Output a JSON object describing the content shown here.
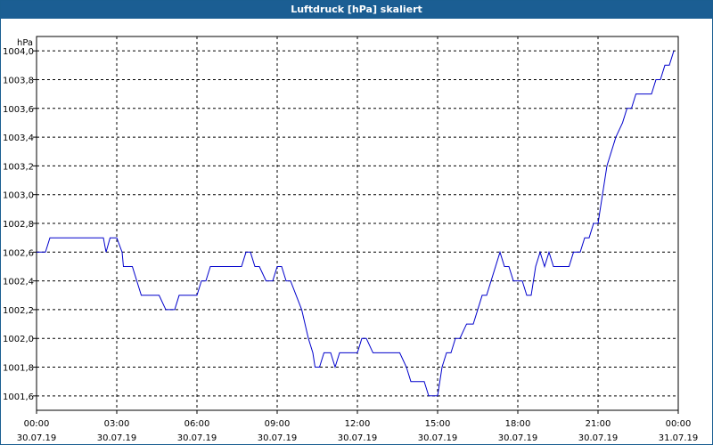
{
  "window": {
    "title": "Luftdruck [hPa] skaliert"
  },
  "chart_data": {
    "type": "line",
    "title": "Luftdruck [hPa] skaliert",
    "ylabel": "hPa",
    "xlabel": "",
    "ylim": [
      1001.5,
      1004.1
    ],
    "y_ticks": [
      "1001,6",
      "1001,8",
      "1002,0",
      "1002,2",
      "1002,4",
      "1002,6",
      "1002,8",
      "1003,0",
      "1003,2",
      "1003,4",
      "1003,6",
      "1003,8",
      "1004,0"
    ],
    "x_ticks": [
      {
        "time": "00:00",
        "date": "30.07.19"
      },
      {
        "time": "03:00",
        "date": "30.07.19"
      },
      {
        "time": "06:00",
        "date": "30.07.19"
      },
      {
        "time": "09:00",
        "date": "30.07.19"
      },
      {
        "time": "12:00",
        "date": "30.07.19"
      },
      {
        "time": "15:00",
        "date": "30.07.19"
      },
      {
        "time": "18:00",
        "date": "30.07.19"
      },
      {
        "time": "21:00",
        "date": "30.07.19"
      },
      {
        "time": "00:00",
        "date": "31.07.19"
      }
    ],
    "grid": true,
    "series": [
      {
        "color": "#0000cc",
        "points": [
          [
            "30.07.19 00:00",
            1002.6
          ],
          [
            "30.07.19 00:20",
            1002.6
          ],
          [
            "30.07.19 00:30",
            1002.7
          ],
          [
            "30.07.19 02:30",
            1002.7
          ],
          [
            "30.07.19 02:36",
            1002.6
          ],
          [
            "30.07.19 02:45",
            1002.7
          ],
          [
            "30.07.19 03:00",
            1002.7
          ],
          [
            "30.07.19 03:12",
            1002.6
          ],
          [
            "30.07.19 03:15",
            1002.5
          ],
          [
            "30.07.19 03:35",
            1002.5
          ],
          [
            "30.07.19 03:55",
            1002.3
          ],
          [
            "30.07.19 04:35",
            1002.3
          ],
          [
            "30.07.19 04:50",
            1002.2
          ],
          [
            "30.07.19 05:10",
            1002.2
          ],
          [
            "30.07.19 05:20",
            1002.3
          ],
          [
            "30.07.19 05:55",
            1002.3
          ],
          [
            "30.07.19 06:00",
            1002.3
          ],
          [
            "30.07.19 06:10",
            1002.4
          ],
          [
            "30.07.19 06:20",
            1002.4
          ],
          [
            "30.07.19 06:30",
            1002.5
          ],
          [
            "30.07.19 07:40",
            1002.5
          ],
          [
            "30.07.19 07:50",
            1002.6
          ],
          [
            "30.07.19 08:00",
            1002.6
          ],
          [
            "30.07.19 08:10",
            1002.5
          ],
          [
            "30.07.19 08:20",
            1002.5
          ],
          [
            "30.07.19 08:35",
            1002.4
          ],
          [
            "30.07.19 08:50",
            1002.4
          ],
          [
            "30.07.19 09:00",
            1002.5
          ],
          [
            "30.07.19 09:10",
            1002.5
          ],
          [
            "30.07.19 09:20",
            1002.4
          ],
          [
            "30.07.19 09:30",
            1002.4
          ],
          [
            "30.07.19 09:55",
            1002.2
          ],
          [
            "30.07.19 10:10",
            1002.0
          ],
          [
            "30.07.19 10:20",
            1001.9
          ],
          [
            "30.07.19 10:25",
            1001.8
          ],
          [
            "30.07.19 10:35",
            1001.8
          ],
          [
            "30.07.19 10:45",
            1001.9
          ],
          [
            "30.07.19 11:00",
            1001.9
          ],
          [
            "30.07.19 11:10",
            1001.8
          ],
          [
            "30.07.19 11:20",
            1001.9
          ],
          [
            "30.07.19 12:00",
            1001.9
          ],
          [
            "30.07.19 12:10",
            1002.0
          ],
          [
            "30.07.19 12:20",
            1002.0
          ],
          [
            "30.07.19 12:35",
            1001.9
          ],
          [
            "30.07.19 13:35",
            1001.9
          ],
          [
            "30.07.19 13:50",
            1001.8
          ],
          [
            "30.07.19 14:00",
            1001.7
          ],
          [
            "30.07.19 14:30",
            1001.7
          ],
          [
            "30.07.19 14:40",
            1001.6
          ],
          [
            "30.07.19 15:00",
            1001.6
          ],
          [
            "30.07.19 15:10",
            1001.8
          ],
          [
            "30.07.19 15:20",
            1001.9
          ],
          [
            "30.07.19 15:30",
            1001.9
          ],
          [
            "30.07.19 15:40",
            1002.0
          ],
          [
            "30.07.19 15:50",
            1002.0
          ],
          [
            "30.07.19 16:05",
            1002.1
          ],
          [
            "30.07.19 16:20",
            1002.1
          ],
          [
            "30.07.19 16:40",
            1002.3
          ],
          [
            "30.07.19 16:50",
            1002.3
          ],
          [
            "30.07.19 17:20",
            1002.6
          ],
          [
            "30.07.19 17:30",
            1002.5
          ],
          [
            "30.07.19 17:40",
            1002.5
          ],
          [
            "30.07.19 17:50",
            1002.4
          ],
          [
            "30.07.19 18:10",
            1002.4
          ],
          [
            "30.07.19 18:20",
            1002.3
          ],
          [
            "30.07.19 18:30",
            1002.3
          ],
          [
            "30.07.19 18:40",
            1002.5
          ],
          [
            "30.07.19 18:50",
            1002.6
          ],
          [
            "30.07.19 19:00",
            1002.5
          ],
          [
            "30.07.19 19:10",
            1002.6
          ],
          [
            "30.07.19 19:20",
            1002.5
          ],
          [
            "30.07.19 19:55",
            1002.5
          ],
          [
            "30.07.19 20:05",
            1002.6
          ],
          [
            "30.07.19 20:20",
            1002.6
          ],
          [
            "30.07.19 20:30",
            1002.7
          ],
          [
            "30.07.19 20:40",
            1002.7
          ],
          [
            "30.07.19 20:50",
            1002.8
          ],
          [
            "30.07.19 21:00",
            1002.8
          ],
          [
            "30.07.19 21:10",
            1003.0
          ],
          [
            "30.07.19 21:20",
            1003.2
          ],
          [
            "30.07.19 21:40",
            1003.4
          ],
          [
            "30.07.19 21:55",
            1003.5
          ],
          [
            "30.07.19 22:05",
            1003.6
          ],
          [
            "30.07.19 22:15",
            1003.6
          ],
          [
            "30.07.19 22:25",
            1003.7
          ],
          [
            "30.07.19 23:00",
            1003.7
          ],
          [
            "30.07.19 23:10",
            1003.8
          ],
          [
            "30.07.19 23:20",
            1003.8
          ],
          [
            "30.07.19 23:30",
            1003.9
          ],
          [
            "30.07.19 23:40",
            1003.9
          ],
          [
            "30.07.19 23:50",
            1004.0
          ]
        ]
      }
    ]
  }
}
